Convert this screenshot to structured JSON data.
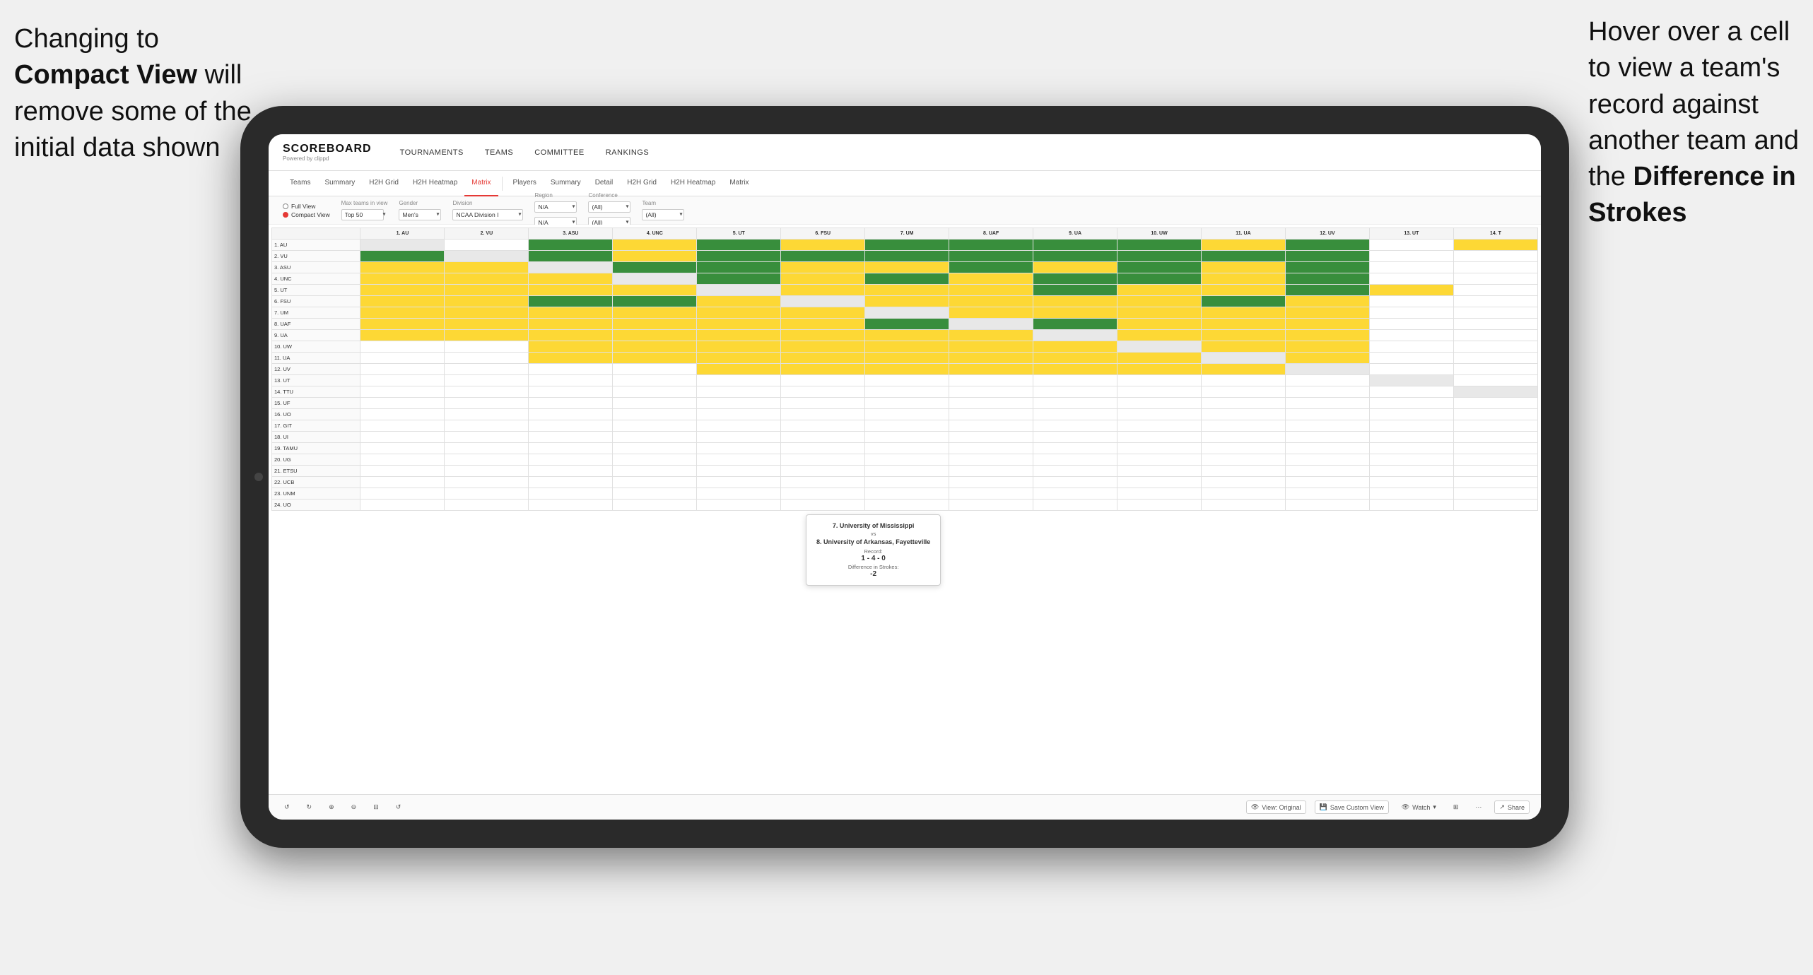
{
  "annotations": {
    "left": {
      "line1": "Changing to",
      "line2": "Compact View will",
      "line3": "remove some of the",
      "line4": "initial data shown"
    },
    "right": {
      "line1": "Hover over a cell",
      "line2": "to view a team's",
      "line3": "record against",
      "line4": "another team and",
      "line5": "the ",
      "line5bold": "Difference in",
      "line6bold": "Strokes"
    }
  },
  "nav": {
    "logo": "SCOREBOARD",
    "logo_sub": "Powered by clippd",
    "items": [
      "TOURNAMENTS",
      "TEAMS",
      "COMMITTEE",
      "RANKINGS"
    ]
  },
  "sub_nav": {
    "groups": [
      {
        "items": [
          "Teams",
          "Summary",
          "H2H Grid",
          "H2H Heatmap",
          "Matrix"
        ]
      },
      {
        "items": [
          "Players",
          "Summary",
          "Detail",
          "H2H Grid",
          "H2H Heatmap",
          "Matrix"
        ]
      }
    ],
    "active": "Matrix"
  },
  "filters": {
    "view_options": [
      "Full View",
      "Compact View"
    ],
    "selected_view": "Compact View",
    "max_teams_label": "Max teams in view",
    "max_teams_value": "Top 50",
    "gender_label": "Gender",
    "gender_value": "Men's",
    "division_label": "Division",
    "division_value": "NCAA Division I",
    "region_label": "Region",
    "region_value": "N/A",
    "conference_label": "Conference",
    "conference_values": [
      "(All)",
      "(All)"
    ],
    "team_label": "Team",
    "team_value": "(All)"
  },
  "matrix": {
    "col_headers": [
      "1. AU",
      "2. VU",
      "3. ASU",
      "4. UNC",
      "5. UT",
      "6. FSU",
      "7. UM",
      "8. UAF",
      "9. UA",
      "10. UW",
      "11. UA",
      "12. UV",
      "13. UT",
      "14. T"
    ],
    "rows": [
      {
        "label": "1. AU",
        "cells": [
          "diag",
          "white",
          "green-dark",
          "yellow",
          "green-dark",
          "yellow",
          "green-dark",
          "green-dark",
          "green-dark",
          "green-dark",
          "yellow",
          "green-dark",
          "white",
          "yellow"
        ]
      },
      {
        "label": "2. VU",
        "cells": [
          "green-dark",
          "diag",
          "green-dark",
          "yellow",
          "green-dark",
          "green-dark",
          "green-dark",
          "green-dark",
          "green-dark",
          "green-dark",
          "green-dark",
          "green-dark",
          "white",
          "white"
        ]
      },
      {
        "label": "3. ASU",
        "cells": [
          "yellow",
          "yellow",
          "diag",
          "green-dark",
          "green-dark",
          "yellow",
          "yellow",
          "green-dark",
          "yellow",
          "green-dark",
          "yellow",
          "green-dark",
          "white",
          "white"
        ]
      },
      {
        "label": "4. UNC",
        "cells": [
          "yellow",
          "yellow",
          "yellow",
          "diag",
          "green-dark",
          "yellow",
          "green-dark",
          "yellow",
          "green-dark",
          "green-dark",
          "yellow",
          "green-dark",
          "white",
          "white"
        ]
      },
      {
        "label": "5. UT",
        "cells": [
          "yellow",
          "yellow",
          "yellow",
          "yellow",
          "diag",
          "yellow",
          "yellow",
          "yellow",
          "green-dark",
          "yellow",
          "yellow",
          "green-dark",
          "yellow",
          "white"
        ]
      },
      {
        "label": "6. FSU",
        "cells": [
          "yellow",
          "yellow",
          "green-dark",
          "green-dark",
          "yellow",
          "diag",
          "yellow",
          "yellow",
          "yellow",
          "yellow",
          "green-dark",
          "yellow",
          "white",
          "white"
        ]
      },
      {
        "label": "7. UM",
        "cells": [
          "yellow",
          "yellow",
          "yellow",
          "yellow",
          "yellow",
          "yellow",
          "diag",
          "yellow",
          "yellow",
          "yellow",
          "yellow",
          "yellow",
          "white",
          "white"
        ]
      },
      {
        "label": "8. UAF",
        "cells": [
          "yellow",
          "yellow",
          "yellow",
          "yellow",
          "yellow",
          "yellow",
          "green-dark",
          "diag",
          "green-dark",
          "yellow",
          "yellow",
          "yellow",
          "white",
          "white"
        ]
      },
      {
        "label": "9. UA",
        "cells": [
          "yellow",
          "yellow",
          "yellow",
          "yellow",
          "yellow",
          "yellow",
          "yellow",
          "yellow",
          "diag",
          "yellow",
          "yellow",
          "yellow",
          "white",
          "white"
        ]
      },
      {
        "label": "10. UW",
        "cells": [
          "white",
          "white",
          "yellow",
          "yellow",
          "yellow",
          "yellow",
          "yellow",
          "yellow",
          "yellow",
          "diag",
          "yellow",
          "yellow",
          "white",
          "white"
        ]
      },
      {
        "label": "11. UA",
        "cells": [
          "white",
          "white",
          "yellow",
          "yellow",
          "yellow",
          "yellow",
          "yellow",
          "yellow",
          "yellow",
          "yellow",
          "diag",
          "yellow",
          "white",
          "white"
        ]
      },
      {
        "label": "12. UV",
        "cells": [
          "white",
          "white",
          "white",
          "white",
          "yellow",
          "yellow",
          "yellow",
          "yellow",
          "yellow",
          "yellow",
          "yellow",
          "diag",
          "white",
          "white"
        ]
      },
      {
        "label": "13. UT",
        "cells": [
          "white",
          "white",
          "white",
          "white",
          "white",
          "white",
          "white",
          "white",
          "white",
          "white",
          "white",
          "white",
          "diag",
          "white"
        ]
      },
      {
        "label": "14. TTU",
        "cells": [
          "white",
          "white",
          "white",
          "white",
          "white",
          "white",
          "white",
          "white",
          "white",
          "white",
          "white",
          "white",
          "white",
          "diag"
        ]
      },
      {
        "label": "15. UF",
        "cells": [
          "white",
          "white",
          "white",
          "white",
          "white",
          "white",
          "white",
          "white",
          "white",
          "white",
          "white",
          "white",
          "white",
          "white"
        ]
      },
      {
        "label": "16. UO",
        "cells": [
          "white",
          "white",
          "white",
          "white",
          "white",
          "white",
          "white",
          "white",
          "white",
          "white",
          "white",
          "white",
          "white",
          "white"
        ]
      },
      {
        "label": "17. GIT",
        "cells": [
          "white",
          "white",
          "white",
          "white",
          "white",
          "white",
          "white",
          "white",
          "white",
          "white",
          "white",
          "white",
          "white",
          "white"
        ]
      },
      {
        "label": "18. UI",
        "cells": [
          "white",
          "white",
          "white",
          "white",
          "white",
          "white",
          "white",
          "white",
          "white",
          "white",
          "white",
          "white",
          "white",
          "white"
        ]
      },
      {
        "label": "19. TAMU",
        "cells": [
          "white",
          "white",
          "white",
          "white",
          "white",
          "white",
          "white",
          "white",
          "white",
          "white",
          "white",
          "white",
          "white",
          "white"
        ]
      },
      {
        "label": "20. UG",
        "cells": [
          "white",
          "white",
          "white",
          "white",
          "white",
          "white",
          "white",
          "white",
          "white",
          "white",
          "white",
          "white",
          "white",
          "white"
        ]
      },
      {
        "label": "21. ETSU",
        "cells": [
          "white",
          "white",
          "white",
          "white",
          "white",
          "white",
          "white",
          "white",
          "white",
          "white",
          "white",
          "white",
          "white",
          "white"
        ]
      },
      {
        "label": "22. UCB",
        "cells": [
          "white",
          "white",
          "white",
          "white",
          "white",
          "white",
          "white",
          "white",
          "white",
          "white",
          "white",
          "white",
          "white",
          "white"
        ]
      },
      {
        "label": "23. UNM",
        "cells": [
          "white",
          "white",
          "white",
          "white",
          "white",
          "white",
          "white",
          "white",
          "white",
          "white",
          "white",
          "white",
          "white",
          "white"
        ]
      },
      {
        "label": "24. UO",
        "cells": [
          "white",
          "white",
          "white",
          "white",
          "white",
          "white",
          "white",
          "white",
          "white",
          "white",
          "white",
          "white",
          "white",
          "white"
        ]
      }
    ]
  },
  "tooltip": {
    "team1": "7. University of Mississippi",
    "vs": "vs",
    "team2": "8. University of Arkansas, Fayetteville",
    "record_label": "Record:",
    "record": "1 - 4 - 0",
    "diff_label": "Difference in Strokes:",
    "diff": "-2"
  },
  "toolbar": {
    "buttons": [
      "↺",
      "↻",
      "⊕",
      "⊖",
      "⊟",
      "↺"
    ],
    "view_original": "View: Original",
    "save_custom": "Save Custom View",
    "watch": "Watch",
    "share": "Share"
  }
}
